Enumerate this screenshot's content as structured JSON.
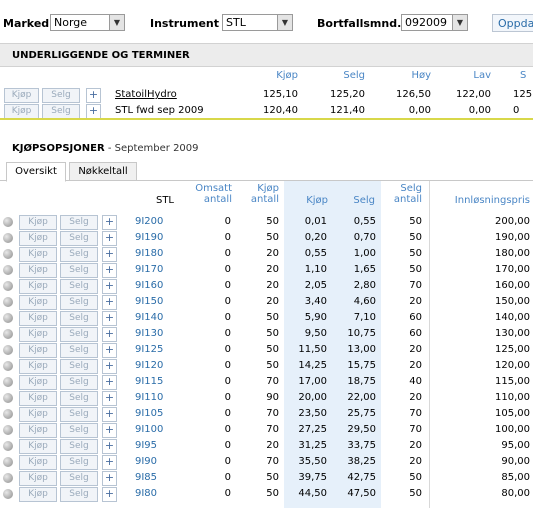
{
  "topbar": {
    "market_label": "Marked",
    "market_value": "Norge",
    "instrument_label": "Instrument",
    "instrument_value": "STL",
    "expiry_label": "Bortfallsmnd.",
    "expiry_value": "092009",
    "update_label": "Oppdater"
  },
  "underlying": {
    "title": "UNDERLIGGENDE OG TERMINER",
    "columns": [
      "Kjøp",
      "Selg",
      "Høy",
      "Lav",
      "S"
    ],
    "rows": [
      {
        "name": "StatoilHydro",
        "values": [
          "125,10",
          "125,20",
          "126,50",
          "122,00",
          "125"
        ]
      },
      {
        "name": "STL fwd sep 2009",
        "values": [
          "120,40",
          "121,40",
          "0,00",
          "0,00",
          "0"
        ]
      }
    ]
  },
  "buttons": {
    "buy": "Kjøp",
    "sell": "Selg",
    "plus": "+"
  },
  "options": {
    "title": "KJØPSOPSJONER",
    "subtitle": " - September 2009",
    "tabs": [
      "Oversikt",
      "Nøkkeltall"
    ],
    "headers": {
      "stl": "STL",
      "omsatt": [
        "Omsatt",
        "antall"
      ],
      "kjop_antall": [
        "Kjøp",
        "antall"
      ],
      "kjop": "Kjøp",
      "selg": "Selg",
      "selg_antall": [
        "Selg",
        "antall"
      ],
      "strike": "Innløsningspris"
    },
    "rows": [
      [
        "9I200",
        "0",
        "50",
        "0,01",
        "0,55",
        "50",
        "200,00"
      ],
      [
        "9I190",
        "0",
        "50",
        "0,20",
        "0,70",
        "50",
        "190,00"
      ],
      [
        "9I180",
        "0",
        "20",
        "0,55",
        "1,00",
        "50",
        "180,00"
      ],
      [
        "9I170",
        "0",
        "20",
        "1,10",
        "1,65",
        "50",
        "170,00"
      ],
      [
        "9I160",
        "0",
        "20",
        "2,05",
        "2,80",
        "70",
        "160,00"
      ],
      [
        "9I150",
        "0",
        "20",
        "3,40",
        "4,60",
        "20",
        "150,00"
      ],
      [
        "9I140",
        "0",
        "50",
        "5,90",
        "7,10",
        "60",
        "140,00"
      ],
      [
        "9I130",
        "0",
        "50",
        "9,50",
        "10,75",
        "60",
        "130,00"
      ],
      [
        "9I125",
        "0",
        "50",
        "11,50",
        "13,00",
        "20",
        "125,00"
      ],
      [
        "9I120",
        "0",
        "50",
        "14,25",
        "15,75",
        "20",
        "120,00"
      ],
      [
        "9I115",
        "0",
        "70",
        "17,00",
        "18,75",
        "40",
        "115,00"
      ],
      [
        "9I110",
        "0",
        "90",
        "20,00",
        "22,00",
        "20",
        "110,00"
      ],
      [
        "9I105",
        "0",
        "70",
        "23,50",
        "25,75",
        "70",
        "105,00"
      ],
      [
        "9I100",
        "0",
        "70",
        "27,25",
        "29,50",
        "70",
        "100,00"
      ],
      [
        "9I95",
        "0",
        "20",
        "31,25",
        "33,75",
        "20",
        "95,00"
      ],
      [
        "9I90",
        "0",
        "70",
        "35,50",
        "38,25",
        "20",
        "90,00"
      ],
      [
        "9I85",
        "0",
        "50",
        "39,75",
        "42,75",
        "50",
        "85,00"
      ],
      [
        "9I80",
        "0",
        "50",
        "44,50",
        "47,50",
        "50",
        "80,00"
      ]
    ]
  }
}
